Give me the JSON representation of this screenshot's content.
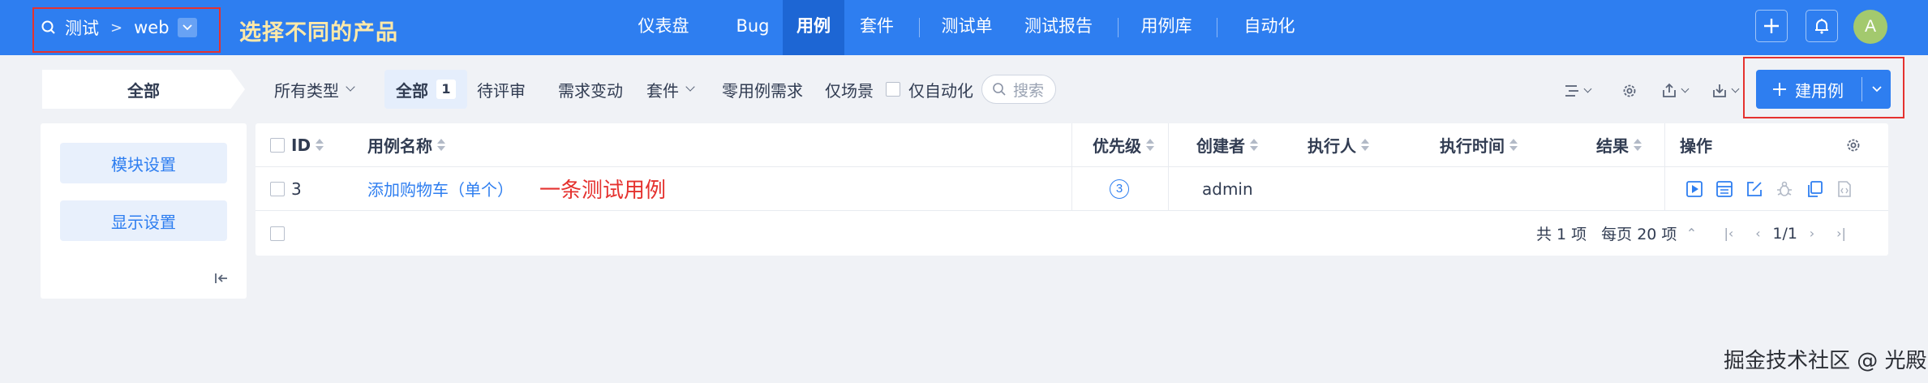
{
  "breadcrumb": {
    "product": "测试",
    "separator": ">",
    "subproduct": "web"
  },
  "annotations": {
    "choose_product": "选择不同的产品",
    "one_case": "一条测试用例"
  },
  "nav": [
    {
      "label": "仪表盘",
      "active": false
    },
    {
      "label": "Bug",
      "active": false
    },
    {
      "label": "用例",
      "active": true
    },
    {
      "label": "套件",
      "active": false
    },
    {
      "label": "测试单",
      "active": false
    },
    {
      "label": "测试报告",
      "active": false
    },
    {
      "label": "用例库",
      "active": false
    },
    {
      "label": "自动化",
      "active": false
    }
  ],
  "user": {
    "avatar_letter": "A"
  },
  "filters": {
    "all_tab": "全部",
    "type_select": "所有类型",
    "all": "全部",
    "all_count": "1",
    "pending_review": "待评审",
    "req_changed": "需求变动",
    "suite": "套件",
    "zero_case_req": "零用例需求",
    "scene_only": "仅场景",
    "auto_only": "仅自动化",
    "search_placeholder": "搜索"
  },
  "toolbar": {
    "new_case": "建用例"
  },
  "left_panel": {
    "module_settings": "模块设置",
    "display_settings": "显示设置"
  },
  "table": {
    "headers": {
      "id": "ID",
      "name": "用例名称",
      "priority": "优先级",
      "creator": "创建者",
      "executor": "执行人",
      "exec_time": "执行时间",
      "result": "结果",
      "actions": "操作"
    },
    "rows": [
      {
        "id": "3",
        "name": "添加购物车（单个）",
        "priority": "3",
        "creator": "admin",
        "executor": "",
        "exec_time": "",
        "result": ""
      }
    ]
  },
  "pagination": {
    "total": "共 1 项",
    "per_page": "每页 20 项",
    "page": "1/1"
  },
  "watermark": "掘金技术社区 @ 光殿",
  "colors": {
    "primary": "#2e7ef0",
    "nav_active": "#1d66d4",
    "annotation_red": "#e5322f",
    "annotation_yellow": "#ffe9a8"
  }
}
